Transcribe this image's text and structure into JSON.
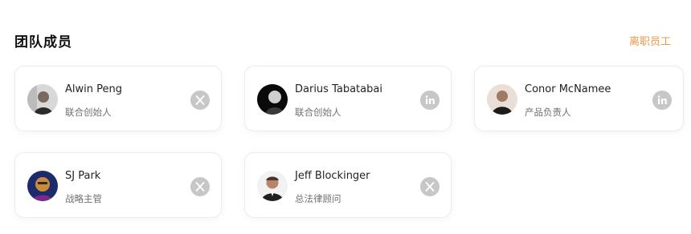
{
  "section": {
    "title": "团队成员",
    "former_link": "离职员工"
  },
  "members": [
    {
      "name": "Alwin Peng",
      "role": "联合创始人",
      "social": "x-twitter-icon"
    },
    {
      "name": "Darius Tabatabai",
      "role": "联合创始人",
      "social": "linkedin-icon"
    },
    {
      "name": "Conor McNamee",
      "role": "产品负责人",
      "social": "linkedin-icon"
    },
    {
      "name": "SJ Park",
      "role": "战略主管",
      "social": "x-twitter-icon"
    },
    {
      "name": "Jeff Blockinger",
      "role": "总法律顾问",
      "social": "x-twitter-icon"
    }
  ],
  "colors": {
    "accent": "#f0974a",
    "icon_bg": "#c7c7c7"
  }
}
